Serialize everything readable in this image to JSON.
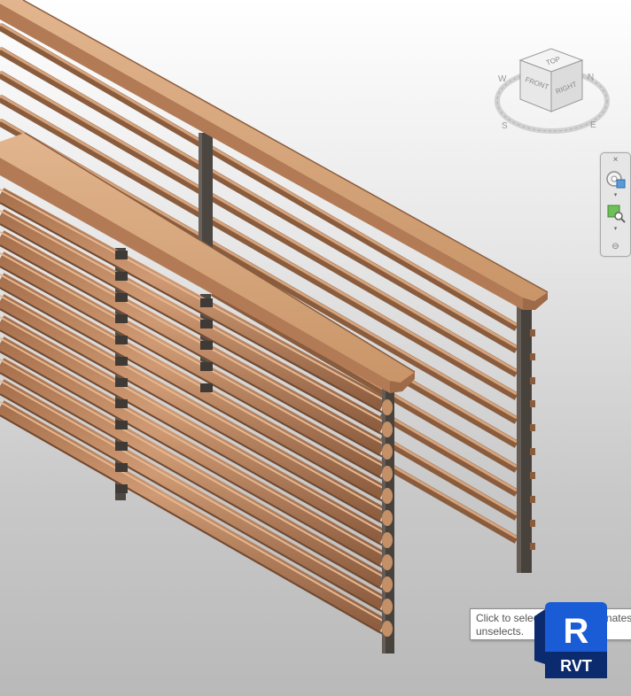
{
  "viewport": {
    "description_icon": "3d-view-canvas"
  },
  "viewcube": {
    "faces": {
      "top": "TOP",
      "front": "FRONT",
      "right": "RIGHT"
    },
    "compass": {
      "n": "N",
      "e": "E",
      "s": "S",
      "w": "W"
    }
  },
  "navbar": {
    "close_icon": "×",
    "dropdown_icon": "▾",
    "options_icon": "⊖"
  },
  "tooltip": {
    "line1": "Click to select, TAB for alternates,",
    "line2": "unselects."
  },
  "badge": {
    "letter": "R",
    "label": "RVT"
  },
  "colors": {
    "wood": "#c8926a",
    "wood_light": "#deb08a",
    "wood_dark": "#9a6a4a",
    "post": "#4a4440",
    "badge_blue": "#1a5bd6",
    "badge_dark": "#0c2a6e"
  }
}
